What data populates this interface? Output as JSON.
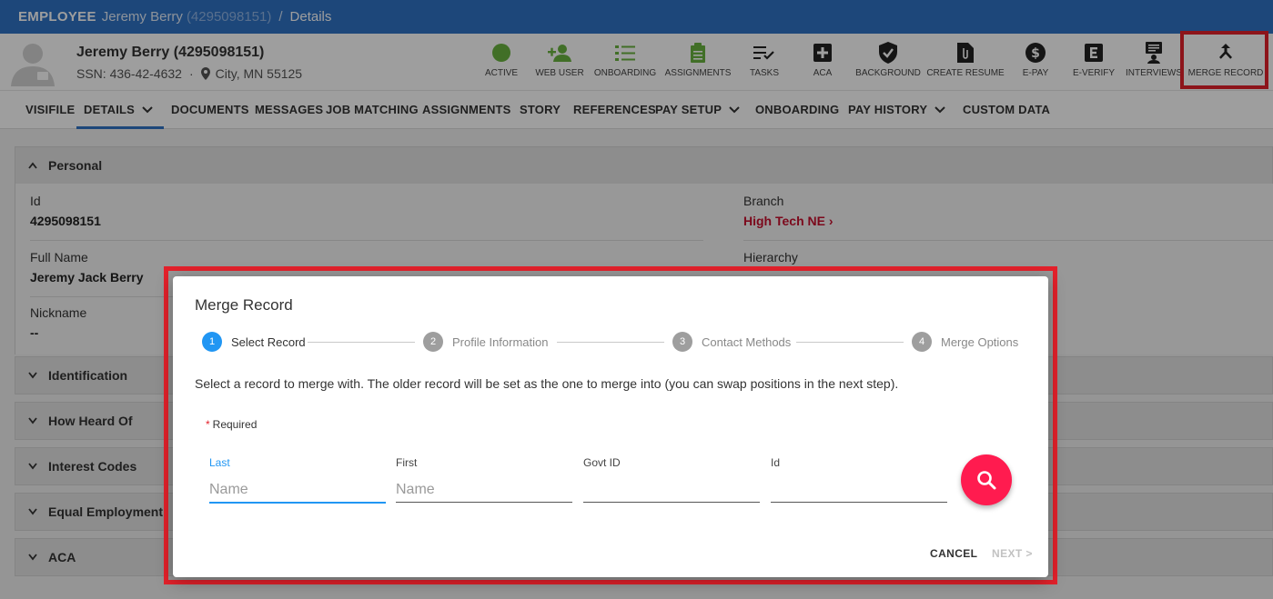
{
  "topbar": {
    "section": "EMPLOYEE",
    "name": "Jeremy Berry",
    "id": "(4295098151)",
    "separator": "/",
    "page": "Details"
  },
  "profile": {
    "name": "Jeremy Berry (4295098151)",
    "ssn": "SSN: 436-42-4632",
    "dot": "·",
    "location": "City, MN 55125"
  },
  "actions": [
    {
      "label": "ACTIVE",
      "icon": "active-dot-icon"
    },
    {
      "label": "WEB USER",
      "icon": "add-user-icon"
    },
    {
      "label": "ONBOARDING",
      "icon": "checklist-icon"
    },
    {
      "label": "ASSIGNMENTS",
      "icon": "clipboard-icon"
    },
    {
      "label": "TASKS",
      "icon": "tasks-icon"
    },
    {
      "label": "ACA",
      "icon": "medical-cross-icon"
    },
    {
      "label": "BACKGROUND",
      "icon": "shield-check-icon"
    },
    {
      "label": "CREATE RESUME",
      "icon": "attachment-doc-icon"
    },
    {
      "label": "E-PAY",
      "icon": "dollar-icon"
    },
    {
      "label": "E-VERIFY",
      "icon": "e-verify-icon"
    },
    {
      "label": "INTERVIEWS",
      "icon": "interview-icon"
    },
    {
      "label": "MERGE RECORD",
      "icon": "merge-icon"
    }
  ],
  "tabs": [
    "VISIFILE",
    "DETAILS",
    "DOCUMENTS",
    "MESSAGES",
    "JOB MATCHING",
    "ASSIGNMENTS",
    "STORY",
    "REFERENCES",
    "PAY SETUP",
    "ONBOARDING",
    "PAY HISTORY",
    "CUSTOM DATA"
  ],
  "panels": [
    "Personal",
    "Identification",
    "How Heard Of",
    "Interest Codes",
    "Equal Employment",
    "ACA"
  ],
  "personal": {
    "id_label": "Id",
    "id_value": "4295098151",
    "fullname_label": "Full Name",
    "fullname_value": "Jeremy Jack Berry",
    "nickname_label": "Nickname",
    "nickname_value": "--",
    "branch_label": "Branch",
    "branch_value": "High Tech NE",
    "hierarchy_label": "Hierarchy"
  },
  "dialog": {
    "title": "Merge Record",
    "steps": [
      {
        "num": "1",
        "label": "Select Record"
      },
      {
        "num": "2",
        "label": "Profile Information"
      },
      {
        "num": "3",
        "label": "Contact Methods"
      },
      {
        "num": "4",
        "label": "Merge Options"
      }
    ],
    "description": "Select a record to merge with. The older record will be set as the one to merge into (you can swap positions in the next step).",
    "required": "Required",
    "required_mark": "*",
    "fields": [
      {
        "label": "Last",
        "placeholder": "Name"
      },
      {
        "label": "First",
        "placeholder": "Name"
      },
      {
        "label": "Govt ID",
        "placeholder": ""
      },
      {
        "label": "Id",
        "placeholder": ""
      }
    ],
    "cancel": "CANCEL",
    "next": "NEXT >"
  },
  "colors": {
    "brand": "#2f73c6",
    "accent": "#ff1b4f",
    "highlight": "#e4212b",
    "step_active": "#2196f3"
  }
}
